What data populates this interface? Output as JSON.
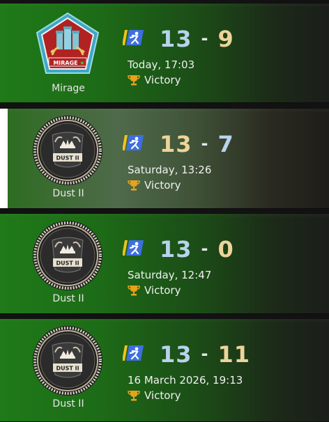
{
  "colors": {
    "ct_score": "#b8d3ec",
    "t_score": "#ecd49a",
    "win_green": "#1f7a18",
    "selected_bar": "#ffffff",
    "trophy": "#e8a21a"
  },
  "matches": [
    {
      "map": "Mirage",
      "map_emblem_icon": "mirage-emblem-icon",
      "emblem_text": "MIRAGE",
      "mode_icon": "competitive-mode-icon",
      "score_left": "13",
      "separator": "-",
      "score_right": "9",
      "date": "Today, 17:03",
      "result_icon": "trophy-icon",
      "result": "Victory",
      "selected": false
    },
    {
      "map": "Dust II",
      "map_emblem_icon": "dust2-emblem-icon",
      "emblem_text": "DUST II",
      "mode_icon": "competitive-mode-icon",
      "score_left": "13",
      "separator": "-",
      "score_right": "7",
      "date": "Saturday, 13:26",
      "result_icon": "trophy-icon",
      "result": "Victory",
      "selected": true
    },
    {
      "map": "Dust II",
      "map_emblem_icon": "dust2-emblem-icon",
      "emblem_text": "DUST II",
      "mode_icon": "competitive-mode-icon",
      "score_left": "13",
      "separator": "-",
      "score_right": "0",
      "date": "Saturday, 12:47",
      "result_icon": "trophy-icon",
      "result": "Victory",
      "selected": false
    },
    {
      "map": "Dust II",
      "map_emblem_icon": "dust2-emblem-icon",
      "emblem_text": "DUST II",
      "mode_icon": "competitive-mode-icon",
      "score_left": "13",
      "separator": "-",
      "score_right": "11",
      "date": "16 March 2026, 19:13",
      "result_icon": "trophy-icon",
      "result": "Victory",
      "selected": false
    }
  ]
}
